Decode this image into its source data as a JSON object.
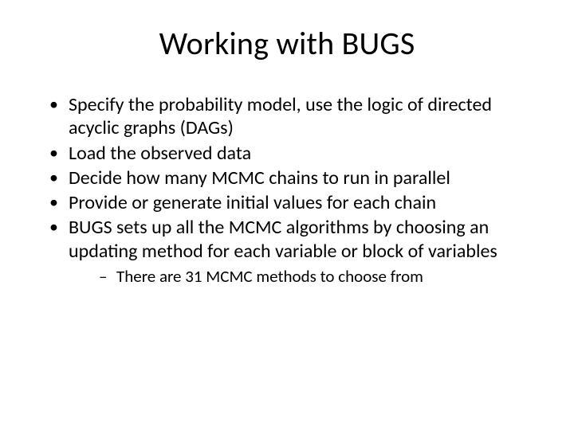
{
  "title": "Working with BUGS",
  "bullets": [
    "Specify the probability model, use the logic of directed acyclic graphs (DAGs)",
    "Load the observed data",
    "Decide how many MCMC chains to run in parallel",
    "Provide or generate initial values for each chain",
    "BUGS sets up all the MCMC algorithms by choosing an updating method for each variable or block of variables"
  ],
  "sub_bullets": [
    "There are 31 MCMC methods to choose from"
  ]
}
